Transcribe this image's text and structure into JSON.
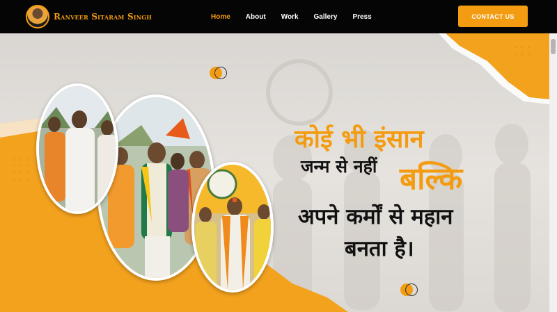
{
  "header": {
    "brand": "Ranveer Sitaram Singh",
    "nav": [
      {
        "label": "Home",
        "active": true
      },
      {
        "label": "About",
        "active": false
      },
      {
        "label": "Work",
        "active": false
      },
      {
        "label": "Gallery",
        "active": false
      },
      {
        "label": "Press",
        "active": false
      }
    ],
    "contact_label": "CONTACT US"
  },
  "hero": {
    "quote_line1": "कोई भी इंसान",
    "quote_line2": "जन्म से नहीं",
    "quote_line2_emphasis": "बल्कि",
    "quote_line3": "अपने कर्मों से महान",
    "quote_line4": "बनता है।"
  },
  "colors": {
    "accent": "#f39c12",
    "header_bg": "#050505",
    "text_dark": "#111111"
  }
}
